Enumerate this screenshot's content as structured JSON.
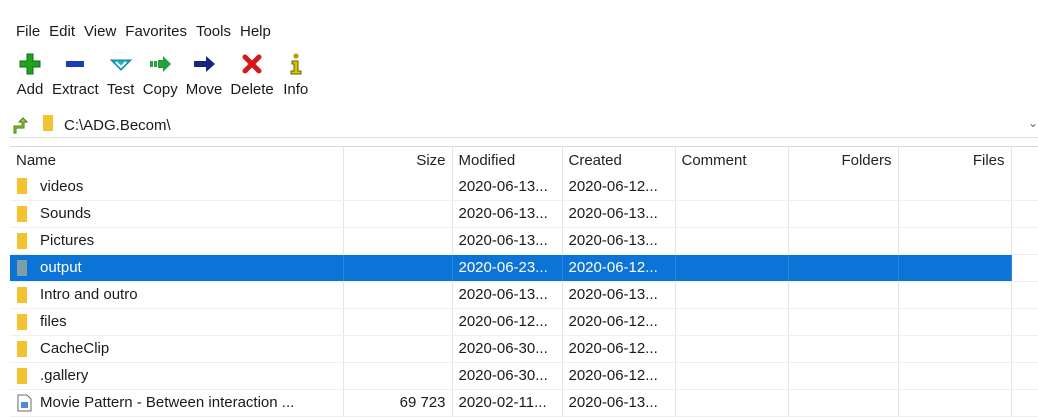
{
  "menu": [
    "File",
    "Edit",
    "View",
    "Favorites",
    "Tools",
    "Help"
  ],
  "toolbar": [
    {
      "label": "Add",
      "icon": "plus-icon",
      "color": "#1fa31f"
    },
    {
      "label": "Extract",
      "icon": "minus-icon",
      "color": "#1a3db8"
    },
    {
      "label": "Test",
      "icon": "check-icon",
      "color": "#19b0c8"
    },
    {
      "label": "Copy",
      "icon": "copy-arrow-icon",
      "color": "#1ea33a"
    },
    {
      "label": "Move",
      "icon": "move-arrow-icon",
      "color": "#1a237e"
    },
    {
      "label": "Delete",
      "icon": "delete-x-icon",
      "color": "#d61818"
    },
    {
      "label": "Info",
      "icon": "info-icon",
      "color": "#b5a000"
    }
  ],
  "address": {
    "path": "C:\\ADG.Becom\\"
  },
  "columns": [
    "Name",
    "Size",
    "Modified",
    "Created",
    "Comment",
    "Folders",
    "Files"
  ],
  "rows": [
    {
      "name": "videos",
      "size": "",
      "modified": "2020-06-13...",
      "created": "2020-06-12...",
      "type": "folder",
      "selected": false
    },
    {
      "name": "Sounds",
      "size": "",
      "modified": "2020-06-13...",
      "created": "2020-06-13...",
      "type": "folder",
      "selected": false
    },
    {
      "name": "Pictures",
      "size": "",
      "modified": "2020-06-13...",
      "created": "2020-06-13...",
      "type": "folder",
      "selected": false
    },
    {
      "name": "output",
      "size": "",
      "modified": "2020-06-23...",
      "created": "2020-06-12...",
      "type": "folder",
      "selected": true
    },
    {
      "name": "Intro and outro",
      "size": "",
      "modified": "2020-06-13...",
      "created": "2020-06-13...",
      "type": "folder",
      "selected": false
    },
    {
      "name": "files",
      "size": "",
      "modified": "2020-06-12...",
      "created": "2020-06-12...",
      "type": "folder",
      "selected": false
    },
    {
      "name": "CacheClip",
      "size": "",
      "modified": "2020-06-30...",
      "created": "2020-06-12...",
      "type": "folder",
      "selected": false
    },
    {
      "name": ".gallery",
      "size": "",
      "modified": "2020-06-30...",
      "created": "2020-06-12...",
      "type": "folder",
      "selected": false
    },
    {
      "name": "Movie Pattern - Between interaction ...",
      "size": "69 723",
      "modified": "2020-02-11...",
      "created": "2020-06-13...",
      "type": "file",
      "selected": false
    }
  ],
  "colors": {
    "folder": "#f2c230",
    "selection": "#0b74d6"
  }
}
